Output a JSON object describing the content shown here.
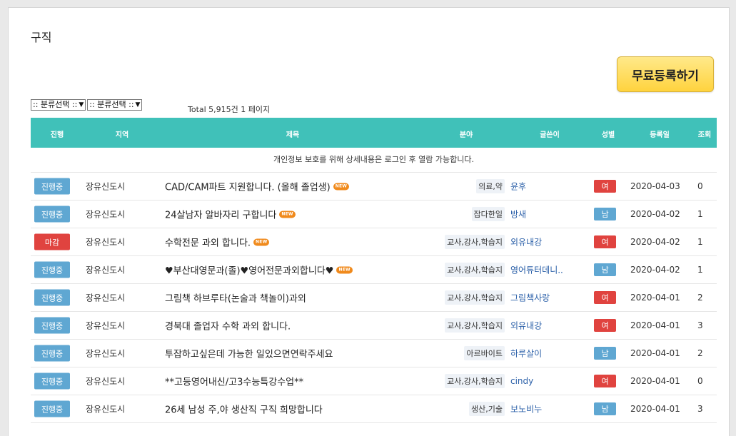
{
  "page": {
    "title": "구직"
  },
  "actions": {
    "register_label": "무료등록하기"
  },
  "filters": [
    {
      "label": ":: 분류선택 ::"
    },
    {
      "label": ":: 분류선택 ::"
    }
  ],
  "total_text": "Total 5,915건 1 페이지",
  "table": {
    "headers": [
      "진행",
      "지역",
      "제목",
      "분야",
      "글쓴이",
      "성별",
      "등록일",
      "조회"
    ],
    "notice": "개인정보 보호를 위해 상세내용은 로그인 후 열람 가능합니다.",
    "new_badge": "NEW",
    "rows": [
      {
        "status": "진행중",
        "status_type": "open",
        "region": "장유신도시",
        "title": "CAD/CAM파트 지원합니다. (올해 졸업생)",
        "is_new": true,
        "category": "의료,약",
        "author": "윤후",
        "gender": "여",
        "gender_type": "f",
        "date": "2020-04-03",
        "views": "0"
      },
      {
        "status": "진행중",
        "status_type": "open",
        "region": "장유신도시",
        "title": "24살남자 알바자리 구합니다",
        "is_new": true,
        "category": "잡다한일",
        "author": "방새",
        "gender": "남",
        "gender_type": "m",
        "date": "2020-04-02",
        "views": "1"
      },
      {
        "status": "마감",
        "status_type": "closed",
        "region": "장유신도시",
        "title": "수학전문 과외 합니다.",
        "is_new": true,
        "category": "교사,강사,학습지",
        "author": "외유내강",
        "gender": "여",
        "gender_type": "f",
        "date": "2020-04-02",
        "views": "1"
      },
      {
        "status": "진행중",
        "status_type": "open",
        "region": "장유신도시",
        "title": "♥부산대영문과(졸)♥영어전문과외합니다♥",
        "is_new": true,
        "category": "교사,강사,학습지",
        "author": "영어튜터데니..",
        "gender": "남",
        "gender_type": "m",
        "date": "2020-04-02",
        "views": "1"
      },
      {
        "status": "진행중",
        "status_type": "open",
        "region": "장유신도시",
        "title": "그림책 하브루타(논술과 책놀이)과외",
        "is_new": false,
        "category": "교사,강사,학습지",
        "author": "그림책사랑",
        "gender": "여",
        "gender_type": "f",
        "date": "2020-04-01",
        "views": "2"
      },
      {
        "status": "진행중",
        "status_type": "open",
        "region": "장유신도시",
        "title": "경북대 졸업자 수학 과외 합니다.",
        "is_new": false,
        "category": "교사,강사,학습지",
        "author": "외유내강",
        "gender": "여",
        "gender_type": "f",
        "date": "2020-04-01",
        "views": "3"
      },
      {
        "status": "진행중",
        "status_type": "open",
        "region": "장유신도시",
        "title": "투잡하고싶은데 가능한 일있으면연락주세요",
        "is_new": false,
        "category": "아르바이트",
        "author": "하루살이",
        "gender": "남",
        "gender_type": "m",
        "date": "2020-04-01",
        "views": "2"
      },
      {
        "status": "진행중",
        "status_type": "open",
        "region": "장유신도시",
        "title": "**고등영어내신/고3수능특강수업**",
        "is_new": false,
        "category": "교사,강사,학습지",
        "author": "cindy",
        "gender": "여",
        "gender_type": "f",
        "date": "2020-04-01",
        "views": "0"
      },
      {
        "status": "진행중",
        "status_type": "open",
        "region": "장유신도시",
        "title": "26세 남성 주,야 생산직 구직 희망합니다",
        "is_new": false,
        "category": "생산,기술",
        "author": "보노비누",
        "gender": "남",
        "gender_type": "m",
        "date": "2020-04-01",
        "views": "3"
      }
    ]
  }
}
